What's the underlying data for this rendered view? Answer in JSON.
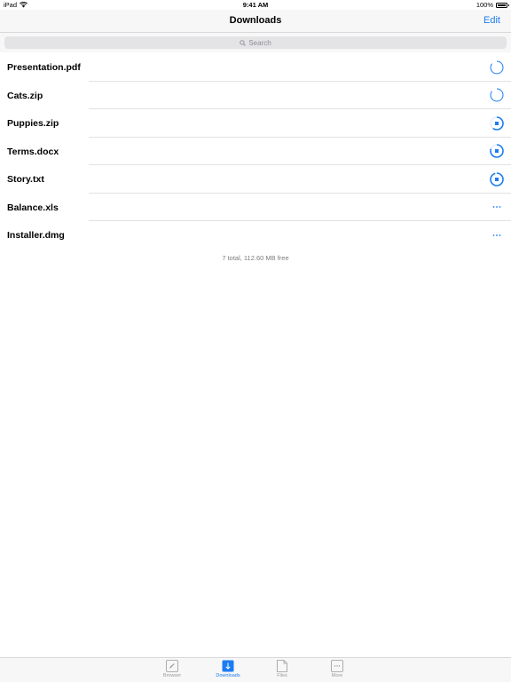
{
  "status_bar": {
    "device": "iPad",
    "time": "9:41 AM",
    "battery_percent": "100%",
    "battery_level": 1.0
  },
  "nav": {
    "title": "Downloads",
    "edit_label": "Edit"
  },
  "search": {
    "placeholder": "Search"
  },
  "downloads": [
    {
      "name": "Presentation.pdf",
      "status": "loading",
      "status_icon": "spinner-icon"
    },
    {
      "name": "Cats.zip",
      "status": "loading",
      "status_icon": "spinner-icon"
    },
    {
      "name": "Puppies.zip",
      "status": "downloading",
      "status_icon": "stop-progress-icon",
      "progress": 0.6
    },
    {
      "name": "Terms.docx",
      "status": "downloading",
      "status_icon": "stop-progress-icon",
      "progress": 0.8
    },
    {
      "name": "Story.txt",
      "status": "downloading",
      "status_icon": "stop-progress-icon",
      "progress": 0.95
    },
    {
      "name": "Balance.xls",
      "status": "queued",
      "status_icon": "more-icon"
    },
    {
      "name": "Installer.dmg",
      "status": "queued",
      "status_icon": "more-icon"
    }
  ],
  "footer": {
    "summary": "7 total, 112.60 MB free"
  },
  "tabs": [
    {
      "label": "Browser",
      "icon": "compass-icon",
      "active": false
    },
    {
      "label": "Downloads",
      "icon": "download-arrow-icon",
      "active": true
    },
    {
      "label": "Files",
      "icon": "file-icon",
      "active": false
    },
    {
      "label": "More",
      "icon": "more-icon",
      "active": false
    }
  ],
  "colors": {
    "accent": "#1b7cf2",
    "separator": "#e2e2e2",
    "bar_background": "#f7f7f7"
  }
}
